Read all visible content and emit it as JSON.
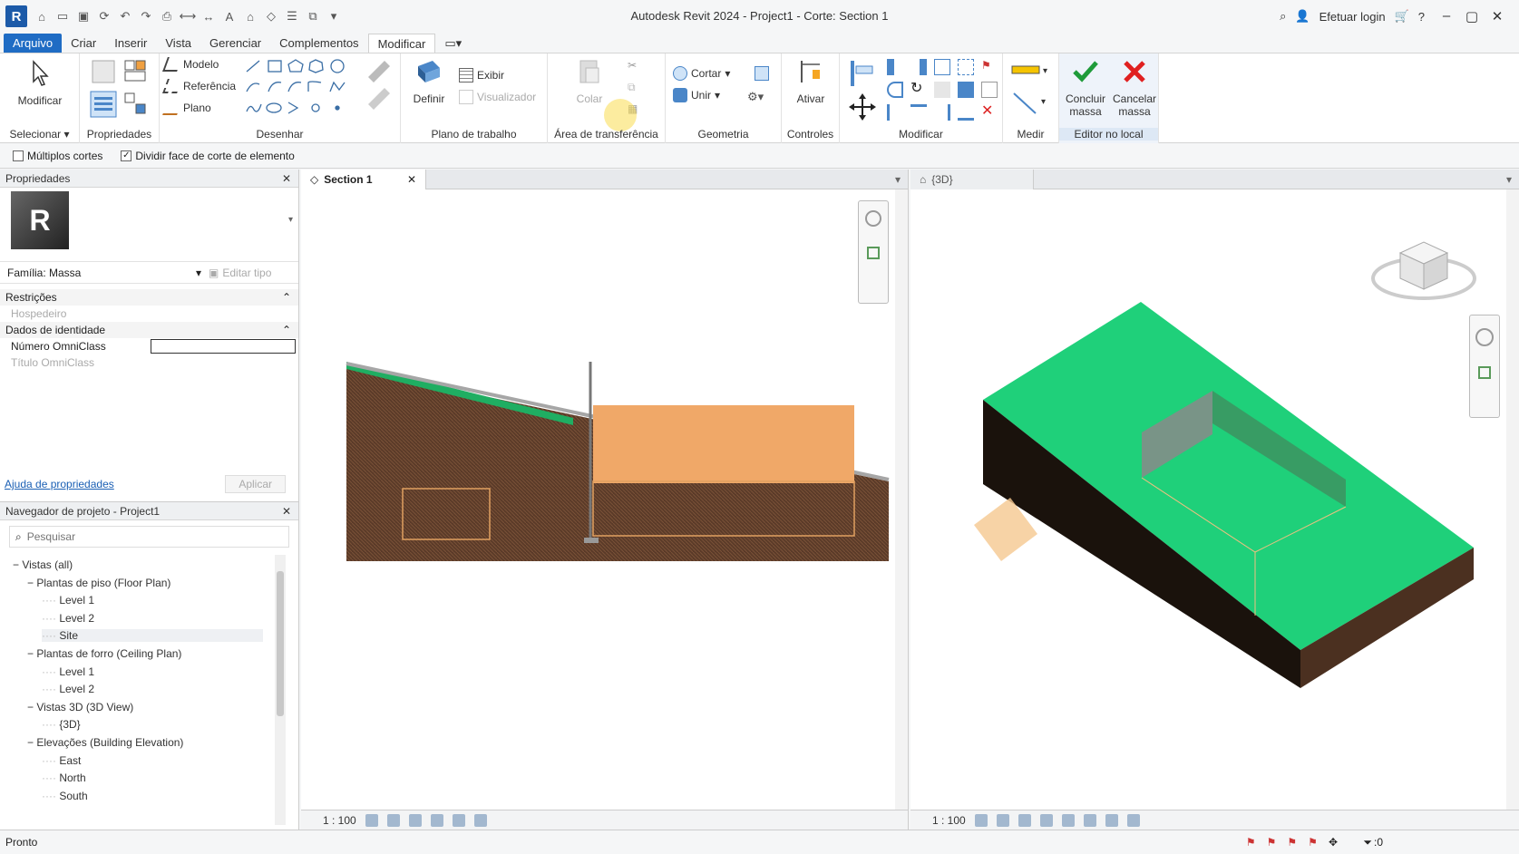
{
  "app": {
    "logo": "R",
    "title": "Autodesk Revit 2024 - Project1 - Corte: Section 1",
    "login": "Efetuar login"
  },
  "tabs": [
    "Arquivo",
    "Criar",
    "Inserir",
    "Vista",
    "Gerenciar",
    "Complementos",
    "Modificar"
  ],
  "ribbon": {
    "selecionar": {
      "label": "Selecionar",
      "btn": "Modificar"
    },
    "propriedades": {
      "label": "Propriedades"
    },
    "desenhar": {
      "label": "Desenhar",
      "items": [
        "Modelo",
        "Referência",
        "Plano"
      ]
    },
    "plano_trabalho": {
      "label": "Plano de trabalho",
      "definir": "Definir",
      "exibir": "Exibir",
      "visualizador": "Visualizador"
    },
    "area_transferencia": {
      "label": "Área de transferência",
      "colar": "Colar"
    },
    "geometria": {
      "label": "Geometria",
      "cortar": "Cortar",
      "unir": "Unir"
    },
    "controles": {
      "label": "Controles",
      "ativar": "Ativar"
    },
    "modificar": {
      "label": "Modificar"
    },
    "medir": {
      "label": "Medir"
    },
    "editor": {
      "label": "Editor no local",
      "concluir": "Concluir massa",
      "cancelar": "Cancelar massa"
    }
  },
  "options": {
    "multiplos": "Múltiplos cortes",
    "dividir": "Dividir face de corte de elemento"
  },
  "properties": {
    "title": "Propriedades",
    "family": "Família: Massa",
    "edit_type": "Editar tipo",
    "sec1": "Restrições",
    "hospedeiro": "Hospedeiro",
    "sec2": "Dados de identidade",
    "omniclass_num": "Número OmniClass",
    "omniclass_title": "Título OmniClass",
    "help": "Ajuda de propriedades",
    "apply": "Aplicar"
  },
  "browser": {
    "title": "Navegador de projeto - Project1",
    "search_placeholder": "Pesquisar",
    "items": [
      {
        "t": "Vistas (all)",
        "lvl": 0
      },
      {
        "t": "Plantas de piso (Floor Plan)",
        "lvl": 1
      },
      {
        "t": "Level 1",
        "lvl": 2
      },
      {
        "t": "Level 2",
        "lvl": 2
      },
      {
        "t": "Site",
        "lvl": 2
      },
      {
        "t": "Plantas de forro (Ceiling Plan)",
        "lvl": 1
      },
      {
        "t": "Level 1",
        "lvl": 2
      },
      {
        "t": "Level 2",
        "lvl": 2
      },
      {
        "t": "Vistas 3D (3D View)",
        "lvl": 1
      },
      {
        "t": "{3D}",
        "lvl": 2
      },
      {
        "t": "Elevações (Building Elevation)",
        "lvl": 1
      },
      {
        "t": "East",
        "lvl": 2
      },
      {
        "t": "North",
        "lvl": 2
      },
      {
        "t": "South",
        "lvl": 2
      }
    ]
  },
  "view1": {
    "tab": "Section 1",
    "scale": "1 : 100"
  },
  "view2": {
    "tab": "{3D}",
    "scale": "1 : 100"
  },
  "status": {
    "text": "Pronto",
    "filter": ":0"
  },
  "colors": {
    "accent": "#1f6cc4",
    "terrain": "#1fd07a",
    "earth": "#5a3a28",
    "mass": "#f0a868"
  }
}
